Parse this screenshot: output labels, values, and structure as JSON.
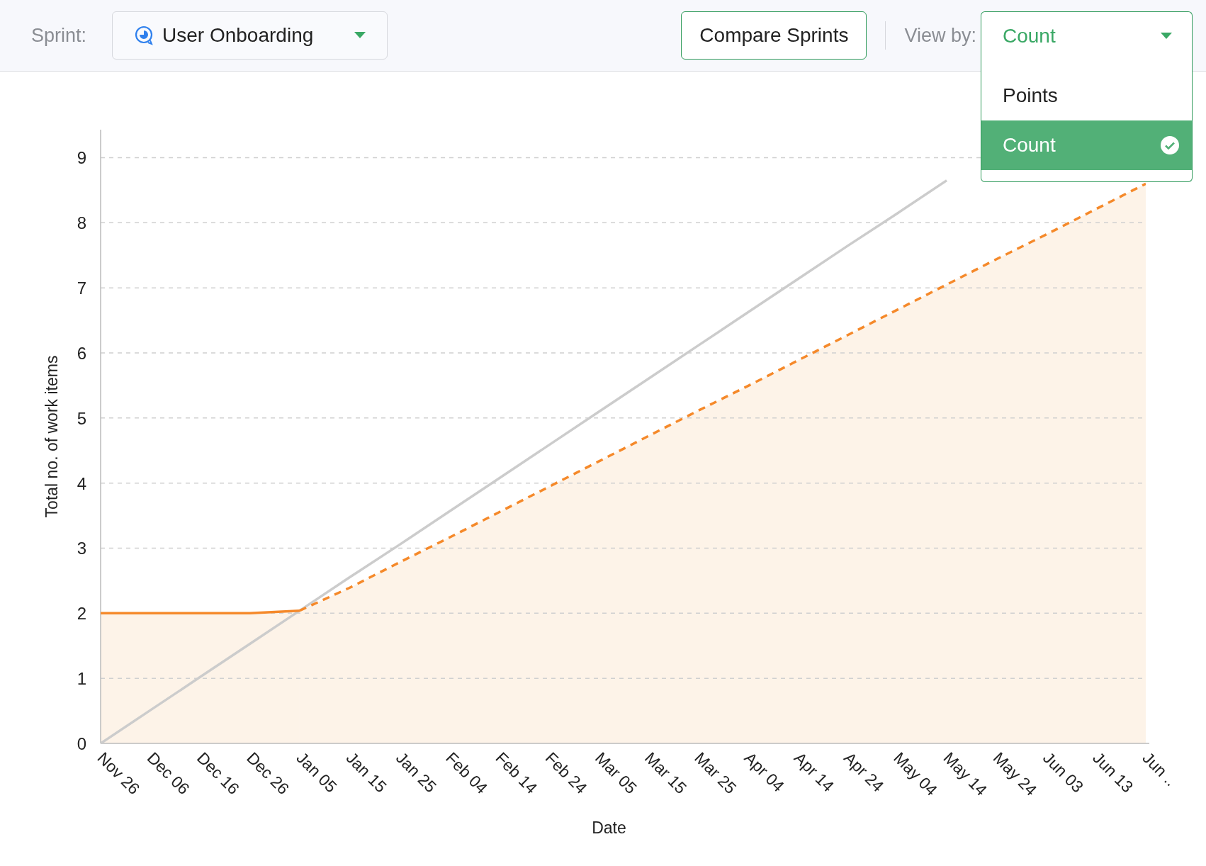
{
  "toolbar": {
    "sprint_label": "Sprint:",
    "sprint_select": {
      "value": "User Onboarding"
    },
    "compare_button": "Compare Sprints",
    "view_by_label": "View by:",
    "view_by_select": {
      "value": "Count",
      "expanded": true,
      "options": [
        {
          "label": "Points",
          "selected": false
        },
        {
          "label": "Count",
          "selected": true
        }
      ]
    }
  },
  "chart": {
    "chart_data": {
      "type": "line",
      "xlabel": "Date",
      "ylabel": "Total no. of work items",
      "categories": [
        "Nov 26",
        "Dec 06",
        "Dec 16",
        "Dec 26",
        "Jan 05",
        "Jan 15",
        "Jan 25",
        "Feb 04",
        "Feb 14",
        "Feb 24",
        "Mar 05",
        "Mar 15",
        "Mar 25",
        "Apr 04",
        "Apr 14",
        "Apr 24",
        "May 04",
        "May 14",
        "May 24",
        "Jun 03",
        "Jun 13",
        "Jun .."
      ],
      "ylim": [
        0,
        9.43
      ],
      "yticks": [
        0,
        1,
        2,
        3,
        4,
        5,
        6,
        7,
        8,
        9
      ],
      "grid": true,
      "series": [
        {
          "color": "#cccccc",
          "type": "line",
          "line_style": "solid",
          "values": [
            0,
            0.51,
            1.02,
            1.53,
            2.04,
            2.55,
            3.05,
            3.56,
            4.07,
            4.58,
            5.09,
            5.6,
            6.11,
            6.62,
            7.13,
            7.64,
            8.14,
            8.65,
            null,
            null,
            null,
            null
          ]
        },
        {
          "color": "#f5892a",
          "type": "area",
          "line_style": "solid",
          "values": [
            2,
            2,
            2,
            2,
            2.04,
            null,
            null,
            null,
            null,
            null,
            null,
            null,
            null,
            null,
            null,
            null,
            null,
            null,
            null,
            null,
            null,
            null
          ]
        },
        {
          "color": "#f5892a",
          "type": "area",
          "line_style": "dashed",
          "values": [
            null,
            null,
            null,
            null,
            2.04,
            2.39,
            2.78,
            3.16,
            3.55,
            3.94,
            4.33,
            4.72,
            5.11,
            5.49,
            5.88,
            6.27,
            6.66,
            7.05,
            7.44,
            7.82,
            8.21,
            8.6
          ]
        }
      ]
    }
  }
}
